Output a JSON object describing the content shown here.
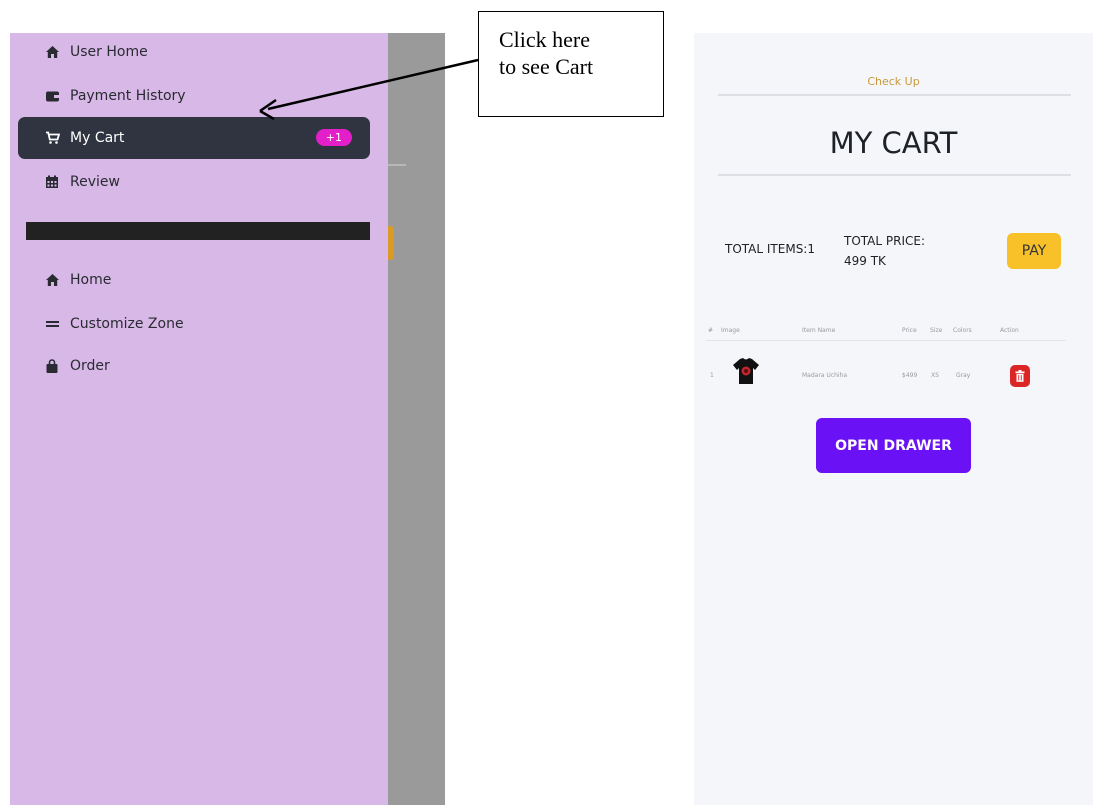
{
  "sidebar": {
    "items": [
      {
        "label": "User Home",
        "icon": "home-icon"
      },
      {
        "label": "Payment History",
        "icon": "wallet-icon"
      },
      {
        "label": "My Cart",
        "icon": "cart-icon",
        "badge": "+1",
        "active": true
      },
      {
        "label": "Review",
        "icon": "calendar-icon"
      }
    ],
    "secondary_items": [
      {
        "label": "Home",
        "icon": "home-icon"
      },
      {
        "label": "Customize Zone",
        "icon": "bars-icon"
      },
      {
        "label": "Order",
        "icon": "bag-icon"
      }
    ]
  },
  "callout": {
    "line1": "Click here",
    "line2": "to see Cart"
  },
  "cart": {
    "checkup": "Check Up",
    "title": "MY CART",
    "total_items": "TOTAL ITEMS:1",
    "total_price_label": "TOTAL PRICE:",
    "total_price_value": "499 TK",
    "pay_label": "PAY",
    "table": {
      "headers": [
        "#",
        "Image",
        "Item Name",
        "Price",
        "Size",
        "Colors",
        "Action"
      ],
      "rows": [
        {
          "index": "1",
          "name": "Madara Uchiha",
          "price": "$499",
          "size": "XS",
          "color": "Gray"
        }
      ]
    },
    "open_drawer_label": "OPEN DRAWER"
  },
  "colors": {
    "drawer_bg": "#d7b8e6",
    "active_item_bg": "#2f3440",
    "badge_bg": "#e31fc9",
    "pay_bg": "#f8c12a",
    "open_drawer_bg": "#6b11f5",
    "delete_bg": "#dc2626"
  }
}
